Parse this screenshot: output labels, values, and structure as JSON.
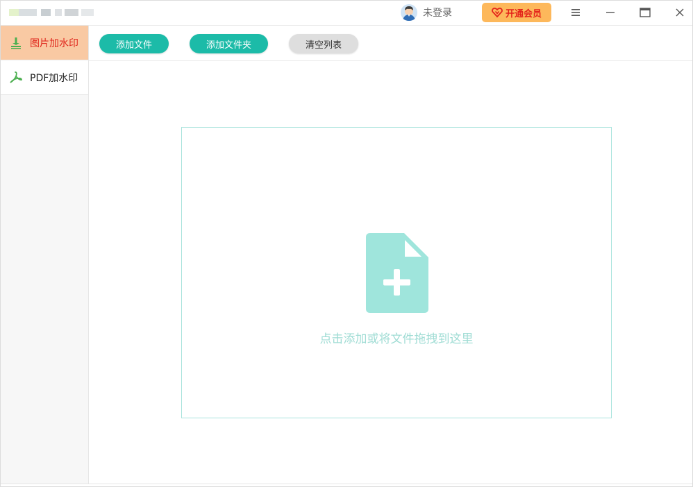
{
  "titlebar": {
    "user_label": "未登录",
    "vip_label": "开通会员",
    "menu_icon": "hamburger-menu-icon",
    "minimize_icon": "minimize-icon",
    "maximize_icon": "maximize-icon",
    "close_icon": "close-icon"
  },
  "sidebar": {
    "items": [
      {
        "label": "图片加水印",
        "icon": "image-stamp-icon",
        "active": true
      },
      {
        "label": "PDF加水印",
        "icon": "pdf-icon",
        "active": false
      }
    ]
  },
  "toolbar": {
    "add_file_label": "添加文件",
    "add_folder_label": "添加文件夹",
    "clear_list_label": "清空列表"
  },
  "dropzone": {
    "text": "点击添加或将文件拖拽到这里",
    "icon": "add-file-icon"
  },
  "colors": {
    "accent": "#1cbba8",
    "active_tab_bg": "#f9c9a3",
    "active_tab_text": "#e0271d",
    "vip_bg": "#fdb85b",
    "dropzone_icon": "#9fe5dc"
  }
}
